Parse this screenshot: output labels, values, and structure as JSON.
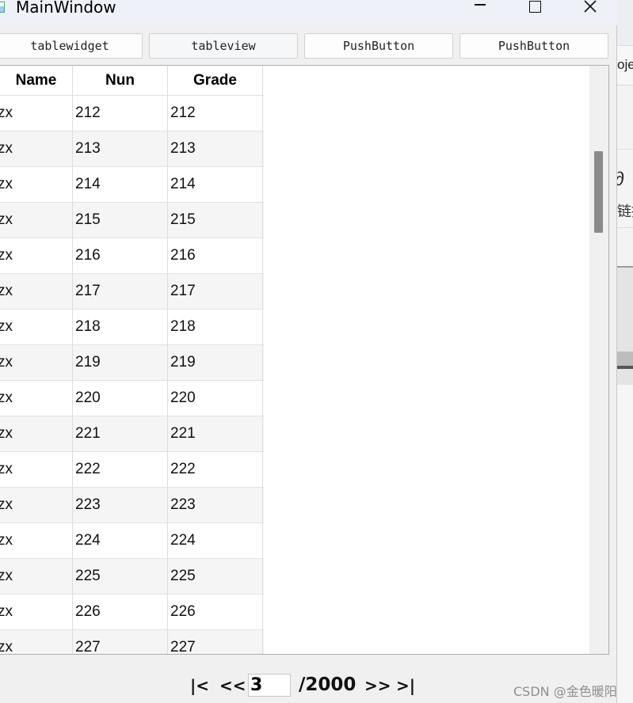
{
  "window": {
    "title": "MainWindow"
  },
  "toolbar": {
    "buttons": [
      "tablewidget",
      "tableview",
      "PushButton",
      "PushButton"
    ]
  },
  "table": {
    "columns": [
      "Name",
      "Nun",
      "Grade"
    ],
    "rows": [
      [
        "zx",
        "212",
        "212"
      ],
      [
        "zx",
        "213",
        "213"
      ],
      [
        "zx",
        "214",
        "214"
      ],
      [
        "zx",
        "215",
        "215"
      ],
      [
        "zx",
        "216",
        "216"
      ],
      [
        "zx",
        "217",
        "217"
      ],
      [
        "zx",
        "218",
        "218"
      ],
      [
        "zx",
        "219",
        "219"
      ],
      [
        "zx",
        "220",
        "220"
      ],
      [
        "zx",
        "221",
        "221"
      ],
      [
        "zx",
        "222",
        "222"
      ],
      [
        "zx",
        "223",
        "223"
      ],
      [
        "zx",
        "224",
        "224"
      ],
      [
        "zx",
        "225",
        "225"
      ],
      [
        "zx",
        "226",
        "226"
      ],
      [
        "zx",
        "227",
        "227"
      ]
    ]
  },
  "pager": {
    "first_label": "|<",
    "prev_label": "<<",
    "current_page": "3",
    "total_label": "/2000",
    "next_label": ">>",
    "last_label": ">|"
  },
  "background_app": {
    "text_1": "oje",
    "text_2": "链接"
  },
  "watermark": "CSDN @金色暖阳"
}
